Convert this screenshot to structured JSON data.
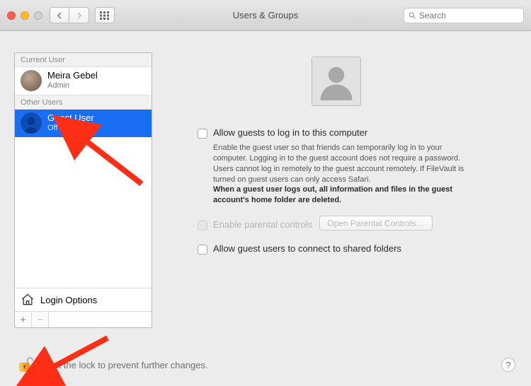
{
  "window": {
    "title": "Users & Groups"
  },
  "search": {
    "placeholder": "Search"
  },
  "sidebar": {
    "sections": {
      "current": "Current User",
      "other": "Other Users"
    },
    "current_user": {
      "name": "Meira Gebel",
      "role": "Admin"
    },
    "guest_user": {
      "name": "Guest User",
      "status": "Off"
    },
    "login_options": "Login Options"
  },
  "main": {
    "allow_login": "Allow guests to log in to this computer",
    "description": "Enable the guest user so that friends can temporarily log in to your computer. Logging in to the guest account does not require a password. Users cannot log in remotely to the guest account remotely. If FileVault is turned on guest users can only access Safari.",
    "description_bold": "When a guest user logs out, all information and files in the guest account's home folder are deleted.",
    "enable_parental": "Enable parental controls",
    "open_parental": "Open Parental Controls…",
    "allow_shared": "Allow guest users to connect to shared folders"
  },
  "footer": {
    "lock_text": "Click the lock to prevent further changes.",
    "help": "?"
  },
  "colors": {
    "selection": "#1a6ef4",
    "arrow": "#ff2e17"
  }
}
